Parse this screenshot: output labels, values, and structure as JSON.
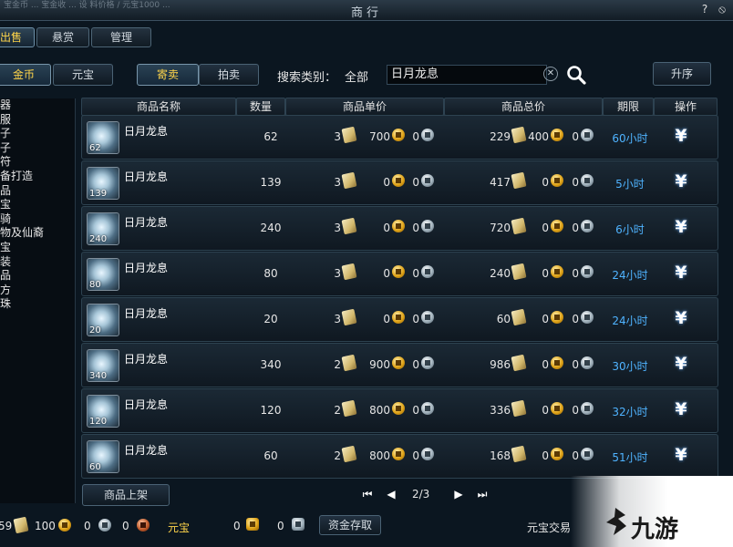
{
  "window": {
    "title": "商行",
    "help_glyph": "?",
    "close_glyph": "⦸",
    "title_junk": "宝金币 ... 宝金收 ... 设 料价格 / 元宝1000 ..."
  },
  "tabs": [
    {
      "label": "出售"
    },
    {
      "label": "悬赏"
    },
    {
      "label": "管理"
    }
  ],
  "currency_tabs": [
    {
      "label": "金币"
    },
    {
      "label": "元宝"
    }
  ],
  "sale_tabs": [
    {
      "label": "寄卖"
    },
    {
      "label": "拍卖"
    }
  ],
  "search": {
    "category_label": "搜索类别：",
    "category_value": "全部",
    "value": "日月龙息",
    "sort_label": "升序"
  },
  "sidebar": {
    "items": [
      "器",
      "服",
      "子",
      "子",
      "符",
      "备打造",
      "品",
      "宝",
      "骑",
      "物及仙裔",
      "宝",
      "装",
      "品",
      "方",
      "珠"
    ]
  },
  "columns": [
    "商品名称",
    "数量",
    "商品单价",
    "商品总价",
    "期限",
    "操作"
  ],
  "rows": [
    {
      "name": "日月龙息",
      "count": "62",
      "qty": "62",
      "unit": [
        "3",
        "700",
        "0"
      ],
      "total": [
        "229",
        "400",
        "0"
      ],
      "duration": "60小时"
    },
    {
      "name": "日月龙息",
      "count": "139",
      "qty": "139",
      "unit": [
        "3",
        "0",
        "0"
      ],
      "total": [
        "417",
        "0",
        "0"
      ],
      "duration": "5小时"
    },
    {
      "name": "日月龙息",
      "count": "240",
      "qty": "240",
      "unit": [
        "3",
        "0",
        "0"
      ],
      "total": [
        "720",
        "0",
        "0"
      ],
      "duration": "6小时"
    },
    {
      "name": "日月龙息",
      "count": "80",
      "qty": "80",
      "unit": [
        "3",
        "0",
        "0"
      ],
      "total": [
        "240",
        "0",
        "0"
      ],
      "duration": "24小时"
    },
    {
      "name": "日月龙息",
      "count": "20",
      "qty": "20",
      "unit": [
        "3",
        "0",
        "0"
      ],
      "total": [
        "60",
        "0",
        "0"
      ],
      "duration": "24小时"
    },
    {
      "name": "日月龙息",
      "count": "340",
      "qty": "340",
      "unit": [
        "2",
        "900",
        "0"
      ],
      "total": [
        "986",
        "0",
        "0"
      ],
      "duration": "30小时"
    },
    {
      "name": "日月龙息",
      "count": "120",
      "qty": "120",
      "unit": [
        "2",
        "800",
        "0"
      ],
      "total": [
        "336",
        "0",
        "0"
      ],
      "duration": "32小时"
    },
    {
      "name": "日月龙息",
      "count": "60",
      "qty": "60",
      "unit": [
        "2",
        "800",
        "0"
      ],
      "total": [
        "168",
        "0",
        "0"
      ],
      "duration": "51小时"
    }
  ],
  "action_glyph": "¥",
  "list_button": "商品上架",
  "pager": {
    "page": "2/3",
    "first": "⏮",
    "prev": "◀",
    "next": "▶",
    "last": "⏭"
  },
  "bottom": {
    "gold_a": "59",
    "gold_b": "100",
    "silver": "0",
    "copper": "0",
    "yuanbao_label": "元宝",
    "yb_a": "0",
    "yb_b": "0",
    "deposit": "资金存取",
    "trade": "元宝交易"
  },
  "watermark": "九游",
  "colors": {
    "accent_gold": "#ffd54a",
    "duration_blue": "#4fb3ff",
    "panel": "#0b1620"
  }
}
